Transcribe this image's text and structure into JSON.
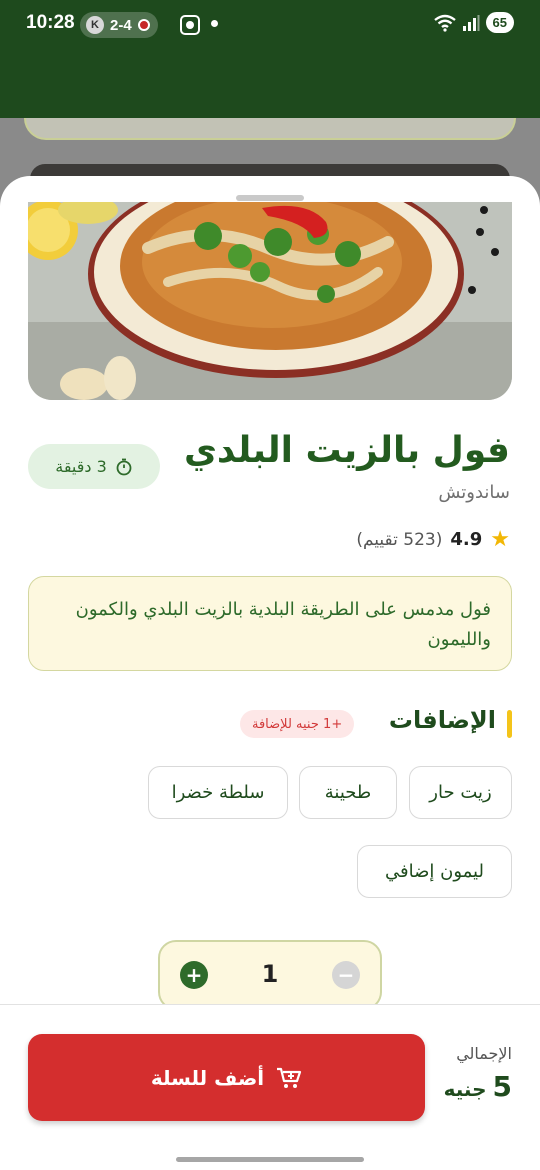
{
  "status_bar": {
    "time": "10:28",
    "pill_letter": "K",
    "pill_text": "2-4",
    "battery": "65"
  },
  "item": {
    "name": "فول بالزيت البلدي",
    "category": "ساندوتش",
    "prep_time": "3 دقيقة",
    "rating_value": "4.9",
    "rating_count": "(523 تقييم)",
    "description": "فول مدمس على الطريقة البلدية بالزيت البلدي والكمون والليمون"
  },
  "addons": {
    "title": "الإضافات",
    "price_tag": "+1 جنيه للإضافة",
    "options": [
      "زيت حار",
      "طحينة",
      "سلطة خضرا",
      "ليمون إضافي"
    ]
  },
  "quantity": {
    "value": "1",
    "minus": "−",
    "plus": "+"
  },
  "footer": {
    "total_label": "الإجمالي",
    "total_amount": "5",
    "currency": "جنيه",
    "add_button": "أضف للسلة"
  },
  "colors": {
    "brand_green": "#235b1f",
    "accent_red": "#d42e2e",
    "highlight_yellow": "#f4c41a"
  },
  "icons": {
    "timer": "stopwatch-icon",
    "star": "star-icon",
    "cart": "cart-plus-icon",
    "plus": "plus-icon",
    "minus": "minus-icon"
  }
}
